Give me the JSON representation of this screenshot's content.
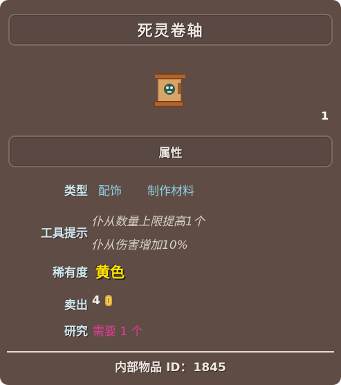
{
  "item": {
    "name": "死灵卷轴",
    "icon": "scroll-icon",
    "corner_mark": "1"
  },
  "section": {
    "title": "属性"
  },
  "properties": {
    "type_label": "类型",
    "type_values": [
      "配饰",
      "制作材料"
    ],
    "tooltip_label": "工具提示",
    "tooltip_lines": [
      "仆从数量上限提高1个",
      "仆从伤害增加10%"
    ],
    "rarity_label": "稀有度",
    "rarity_value": "黄色",
    "sell_label": "卖出",
    "sell_value": "4",
    "sell_icon": "gold-coin-icon",
    "research_label": "研究",
    "research_value": "需要 1 个"
  },
  "footer": {
    "label": "内部物品 ID：",
    "id": "1845"
  },
  "colors": {
    "panel_bg": "#5f4d45",
    "label": "#cfe7ef",
    "type_value": "#8fd0e6",
    "rarity_yellow": "#ffe600",
    "research_pink": "#e83a9a"
  }
}
